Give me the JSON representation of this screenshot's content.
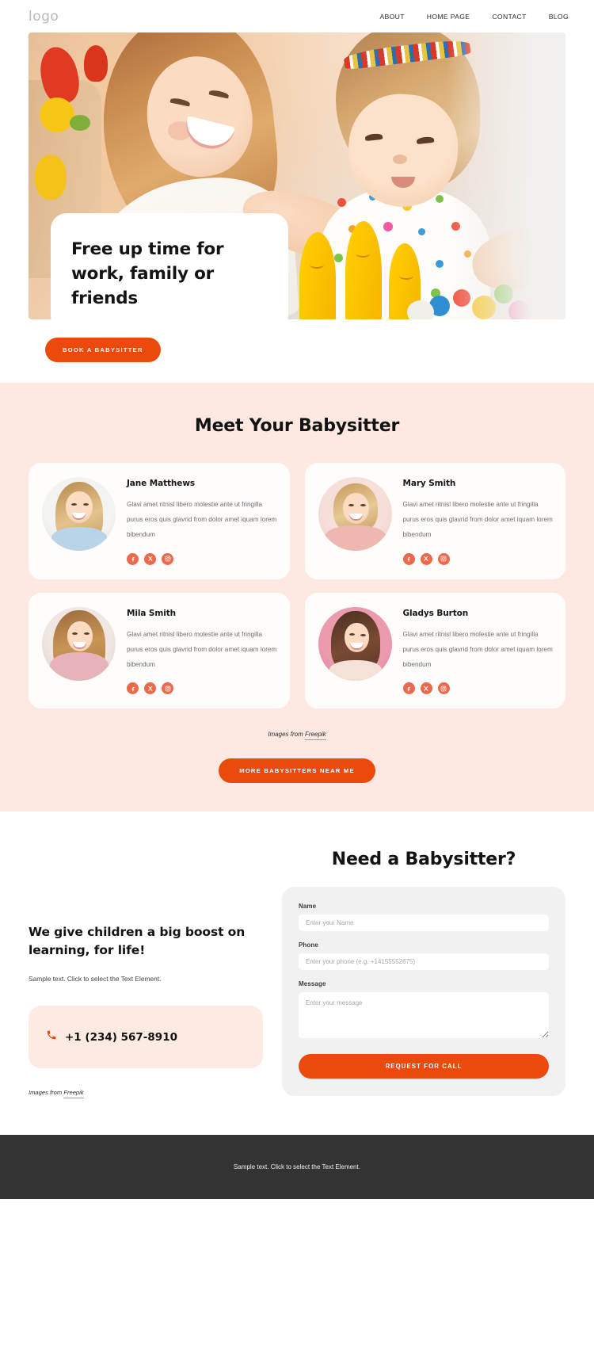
{
  "header": {
    "logo": "logo",
    "nav": [
      {
        "label": "ABOUT"
      },
      {
        "label": "HOME PAGE"
      },
      {
        "label": "CONTACT"
      },
      {
        "label": "BLOG"
      }
    ]
  },
  "hero": {
    "title": "Free up time  for work, family or friends",
    "cta": "BOOK A BABYSITTER"
  },
  "sitters": {
    "title": "Meet Your Babysitter",
    "description": "Glavi amet ritnisl libero molestie ante ut fringilla purus eros quis glavrid from dolor amet iquam lorem bibendum",
    "cards": [
      {
        "name": "Jane Matthews"
      },
      {
        "name": "Mary Smith"
      },
      {
        "name": "Mila Smith"
      },
      {
        "name": "Gladys Burton"
      }
    ],
    "social_icons": [
      "facebook-icon",
      "x-twitter-icon",
      "instagram-icon"
    ],
    "credit_prefix": "Images from ",
    "credit_link": "Freepik",
    "cta": "MORE BABYSITTERS NEAR ME"
  },
  "boost": {
    "title": "We give children a big boost on learning, for life!",
    "text": "Sample text. Click to select the Text Element.",
    "phone": "+1 (234) 567-8910",
    "phone_icon": "phone-icon",
    "credit_prefix": "Images from ",
    "credit_link": "Freepik"
  },
  "form": {
    "title": "Need a Babysitter?",
    "name_label": "Name",
    "name_placeholder": "Enter your Name",
    "phone_label": "Phone",
    "phone_placeholder": "Enter your phone (e.g. +14155552675)",
    "message_label": "Message",
    "message_placeholder": "Enter your message",
    "submit": "REQUEST FOR CALL"
  },
  "footer": {
    "text": "Sample text. Click to select the Text Element."
  },
  "colors": {
    "accent": "#ec4a0d",
    "social": "#ea6a4b",
    "section_bg": "#fde9e1",
    "form_bg": "#f1f1f1",
    "footer_bg": "#333333"
  }
}
